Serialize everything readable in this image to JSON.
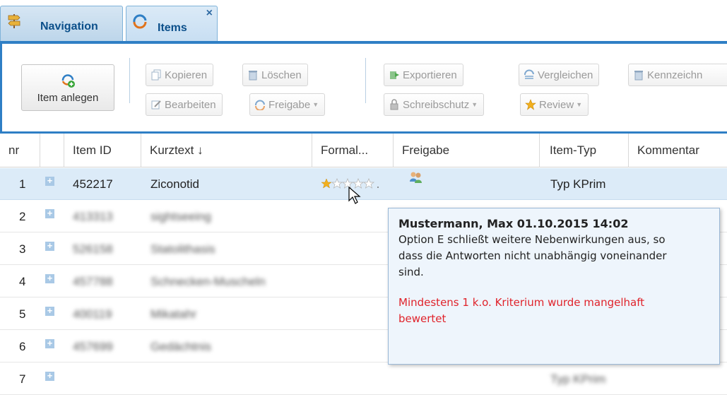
{
  "tabs": {
    "navigation": "Navigation",
    "items": "Items",
    "close": "×"
  },
  "toolbar": {
    "create": "Item anlegen",
    "copy": "Kopieren",
    "delete": "Löschen",
    "edit": "Bearbeiten",
    "release": "Freigabe",
    "export": "Exportieren",
    "writeprotect": "Schreibschutz",
    "compare": "Vergleichen",
    "review": "Review",
    "mark": "Kennzeichn"
  },
  "columns": [
    "nr",
    "Item ID",
    "Kurztext ↓",
    "Formal...",
    "Freigabe",
    "Item-Typ",
    "Kommentar"
  ],
  "rows": [
    {
      "nr": "1",
      "id": "452217",
      "text": "Ziconotid",
      "type": "Typ KPrim"
    },
    {
      "nr": "2",
      "id": "413313",
      "text": "sightseeing",
      "type": ""
    },
    {
      "nr": "3",
      "id": "526158",
      "text": "Statolithasis",
      "type": ""
    },
    {
      "nr": "4",
      "id": "457788",
      "text": "Schnecken-Muscheln",
      "type": ""
    },
    {
      "nr": "5",
      "id": "400119",
      "text": "Mikatahr",
      "type": ""
    },
    {
      "nr": "6",
      "id": "457699",
      "text": "Gedächtnis",
      "type": ""
    },
    {
      "nr": "7",
      "id": "",
      "text": "",
      "type": "Typ KPrim"
    }
  ],
  "rating": {
    "value": 1,
    "max": 5
  },
  "tooltip": {
    "header": "Mustermann, Max 01.10.2015 14:02",
    "line1": "Option E schließt weitere Nebenwirkungen aus, so",
    "line2": "dass die Antworten nicht unabhängig voneinander",
    "line3": "sind.",
    "warn1": "Mindestens 1 k.o. Kriterium wurde mangelhaft",
    "warn2": "bewertet"
  },
  "colors": {
    "accent": "#2f7fc5",
    "selected_row": "#dcebf8",
    "warning": "#e0232b"
  },
  "icons": [
    "signpost-icon",
    "items-icon",
    "add-item-icon",
    "copy-icon",
    "delete-icon",
    "edit-icon",
    "release-icon",
    "export-icon",
    "lock-icon",
    "compare-icon",
    "star-icon",
    "mark-icon",
    "release-users-icon",
    "expand-icon",
    "mouse-cursor-icon"
  ]
}
